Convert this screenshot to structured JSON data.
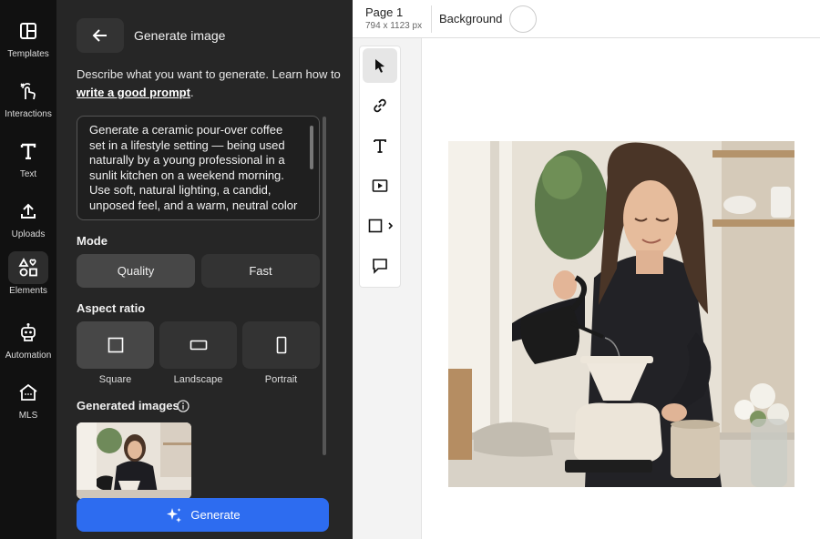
{
  "rail": {
    "items": [
      {
        "label": "Templates",
        "icon": "templates-icon"
      },
      {
        "label": "Interactions",
        "icon": "interactions-icon"
      },
      {
        "label": "Text",
        "icon": "text-icon"
      },
      {
        "label": "Uploads",
        "icon": "upload-icon"
      },
      {
        "label": "Elements",
        "icon": "elements-icon"
      },
      {
        "label": "Automation",
        "icon": "robot-icon"
      },
      {
        "label": "MLS",
        "icon": "house-icon"
      }
    ],
    "active_index": 4
  },
  "panel": {
    "title": "Generate image",
    "description_prefix": "Describe what you want to generate. Learn how to ",
    "description_link": "write a good prompt",
    "description_suffix": ".",
    "prompt": "Generate a ceramic pour-over coffee set in a lifestyle setting — being used naturally by a young professional in a sunlit kitchen on a weekend morning. Use soft, natural lighting, a candid, unposed feel, and a warm, neutral color",
    "mode_label": "Mode",
    "modes": [
      "Quality",
      "Fast"
    ],
    "selected_mode": "Quality",
    "aspect_label": "Aspect ratio",
    "aspects": [
      "Square",
      "Landscape",
      "Portrait"
    ],
    "selected_aspect": "Square",
    "generated_label": "Generated images",
    "generate_button": "Generate"
  },
  "topbar": {
    "page_label": "Page 1",
    "page_size": "794 x 1123 px",
    "background_label": "Background",
    "background_color": "#ffffff"
  },
  "tools": [
    "pointer-icon",
    "link-icon",
    "text-icon",
    "video-icon",
    "shape-icon",
    "comment-icon"
  ],
  "colors": {
    "accent": "#2d6cf0",
    "rail_bg": "#111111",
    "panel_bg": "#262626"
  }
}
